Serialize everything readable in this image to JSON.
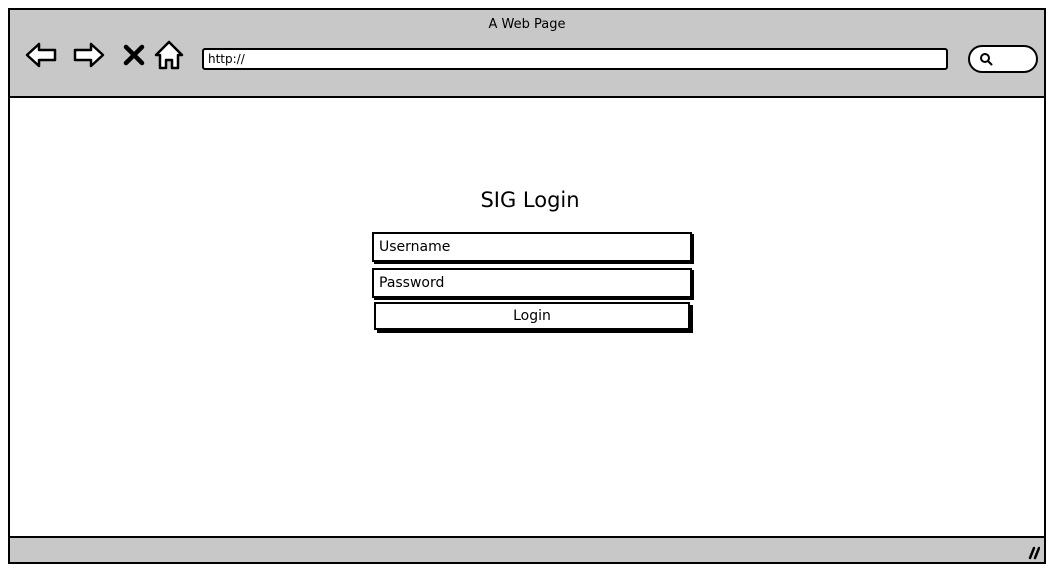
{
  "window": {
    "title": "A Web Page"
  },
  "toolbar": {
    "back_icon": "back-arrow-icon",
    "forward_icon": "forward-arrow-icon",
    "stop_icon": "close-icon",
    "home_icon": "home-icon",
    "address_value": "http://",
    "search_icon": "search-icon"
  },
  "login": {
    "title": "SIG Login",
    "username_placeholder": "Username",
    "password_placeholder": "Password",
    "button_label": "Login"
  },
  "statusbar": {
    "grip_icon": "resize-grip-icon"
  }
}
